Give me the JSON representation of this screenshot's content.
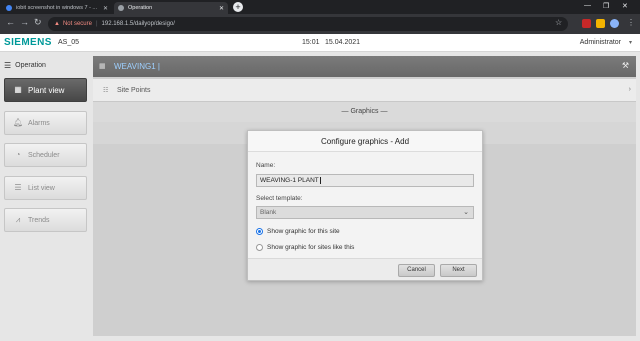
{
  "browser": {
    "tabs": [
      {
        "label": "iobit screenshot in windows 7 - ...",
        "active": false
      },
      {
        "label": "Operation",
        "active": true
      }
    ],
    "new_tab": "+",
    "window_controls": [
      "—",
      "❐",
      "✕"
    ],
    "security_label": "Not secure",
    "url": "192.168.1.5/dailyop/desigo/",
    "nav_icons": [
      "back-icon",
      "forward-icon",
      "reload-icon"
    ],
    "colors": {
      "tabstrip": "#202124",
      "toolbar": "#35363a"
    }
  },
  "header": {
    "logo": "SIEMENS",
    "station": "AS_05",
    "time": "15:01",
    "date": "15.04.2021",
    "user": "Administrator",
    "colors": {
      "brand": "#009999"
    }
  },
  "sidebar": {
    "heading": "Operation",
    "items": [
      {
        "label": "Plant view",
        "icon": "plant-view-icon",
        "active": true
      },
      {
        "label": "Alarms",
        "icon": "bell-icon",
        "active": false
      },
      {
        "label": "Scheduler",
        "icon": "clock-icon",
        "active": false
      },
      {
        "label": "List view",
        "icon": "list-icon",
        "active": false
      },
      {
        "label": "Trends",
        "icon": "trend-icon",
        "active": false
      }
    ]
  },
  "main": {
    "breadcrumb": "WEAVING1 |",
    "site_points_label": "Site Points",
    "graphics_header": "— Graphics —"
  },
  "dialog": {
    "title": "Configure graphics - Add",
    "name_label": "Name:",
    "name_value": "WEAVING-1 PLANT",
    "template_label": "Select template:",
    "template_value": "Blank",
    "options": [
      {
        "label": "Show graphic for this site",
        "selected": true
      },
      {
        "label": "Show graphic for sites like this",
        "selected": false
      }
    ],
    "cancel_label": "Cancel",
    "next_label": "Next"
  }
}
